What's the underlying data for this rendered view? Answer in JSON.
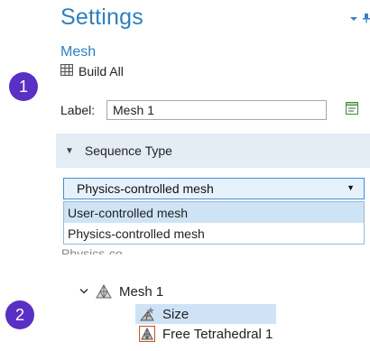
{
  "settings": {
    "title": "Settings",
    "node_title": "Mesh",
    "build_all_label": "Build All",
    "label_caption": "Label:",
    "label_value": "Mesh 1",
    "section_title": "Sequence Type",
    "select_value": "Physics-controlled mesh",
    "options": [
      "User-controlled mesh",
      "Physics-controlled mesh"
    ],
    "behind_text": "Physics-co..."
  },
  "tree": {
    "root_label": "Mesh 1",
    "children": [
      "Size",
      "Free Tetrahedral 1"
    ]
  },
  "badges": [
    "1",
    "2"
  ],
  "colors": {
    "title_blue": "#2e7fc0",
    "badge_purple": "#5a2fc4",
    "selection_blue": "#cfe3f6",
    "section_bg": "#e4ecf4"
  },
  "icons": [
    "chevron-down-icon",
    "pin-icon",
    "build-all-icon",
    "edit-label-icon",
    "mesh-icon",
    "size-icon",
    "free-tetrahedral-icon"
  ]
}
